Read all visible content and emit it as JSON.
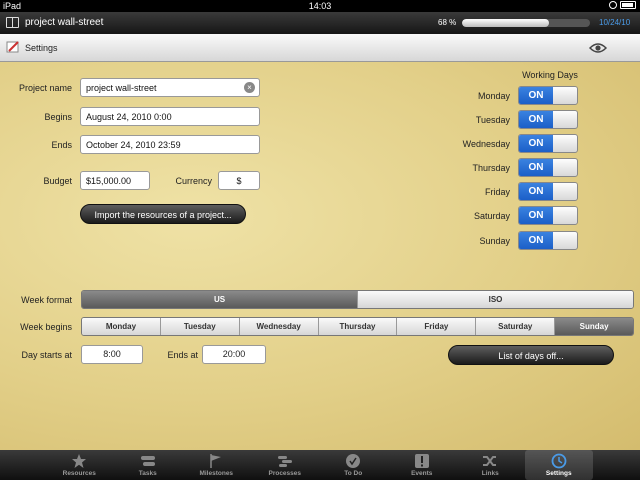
{
  "status_bar": {
    "device": "iPad",
    "time": "14:03"
  },
  "app_bar": {
    "title": "project wall-street",
    "progress_text": "68 %",
    "progress_value": 0.68,
    "date": "10/24/10"
  },
  "header": {
    "title": "Settings"
  },
  "form": {
    "project_name_label": "Project name",
    "project_name": "project wall-street",
    "begins_label": "Begins",
    "begins": "August 24, 2010 0:00",
    "ends_label": "Ends",
    "ends": "October 24, 2010 23:59",
    "budget_label": "Budget",
    "budget": "$15,000.00",
    "currency_label": "Currency",
    "currency": "$",
    "import_button": "Import the resources of a project..."
  },
  "working_days": {
    "title": "Working Days",
    "days": [
      {
        "label": "Monday",
        "state": "ON"
      },
      {
        "label": "Tuesday",
        "state": "ON"
      },
      {
        "label": "Wednesday",
        "state": "ON"
      },
      {
        "label": "Thursday",
        "state": "ON"
      },
      {
        "label": "Friday",
        "state": "ON"
      },
      {
        "label": "Saturday",
        "state": "ON"
      },
      {
        "label": "Sunday",
        "state": "ON"
      }
    ]
  },
  "week_format": {
    "label": "Week format",
    "options": [
      "US",
      "ISO"
    ],
    "selected": "US"
  },
  "week_begins": {
    "label": "Week begins",
    "options": [
      "Monday",
      "Tuesday",
      "Wednesday",
      "Thursday",
      "Friday",
      "Saturday",
      "Sunday"
    ],
    "selected": "Sunday"
  },
  "day_hours": {
    "starts_label": "Day starts at",
    "starts": "8:00",
    "ends_label": "Ends at",
    "ends": "20:00",
    "days_off_button": "List of days off..."
  },
  "tabs": [
    {
      "label": "Resources",
      "icon": "star-icon"
    },
    {
      "label": "Tasks",
      "icon": "tasks-icon"
    },
    {
      "label": "Milestones",
      "icon": "flag-icon"
    },
    {
      "label": "Processes",
      "icon": "processes-icon"
    },
    {
      "label": "To Do",
      "icon": "checkmark-icon"
    },
    {
      "label": "Events",
      "icon": "exclamation-icon"
    },
    {
      "label": "Links",
      "icon": "shuffle-icon"
    },
    {
      "label": "Settings",
      "icon": "clock-icon",
      "selected": true
    }
  ],
  "colors": {
    "accent": "#1b5fc8",
    "date_blue": "#4a9be8",
    "parchment": "#e2cf88"
  }
}
